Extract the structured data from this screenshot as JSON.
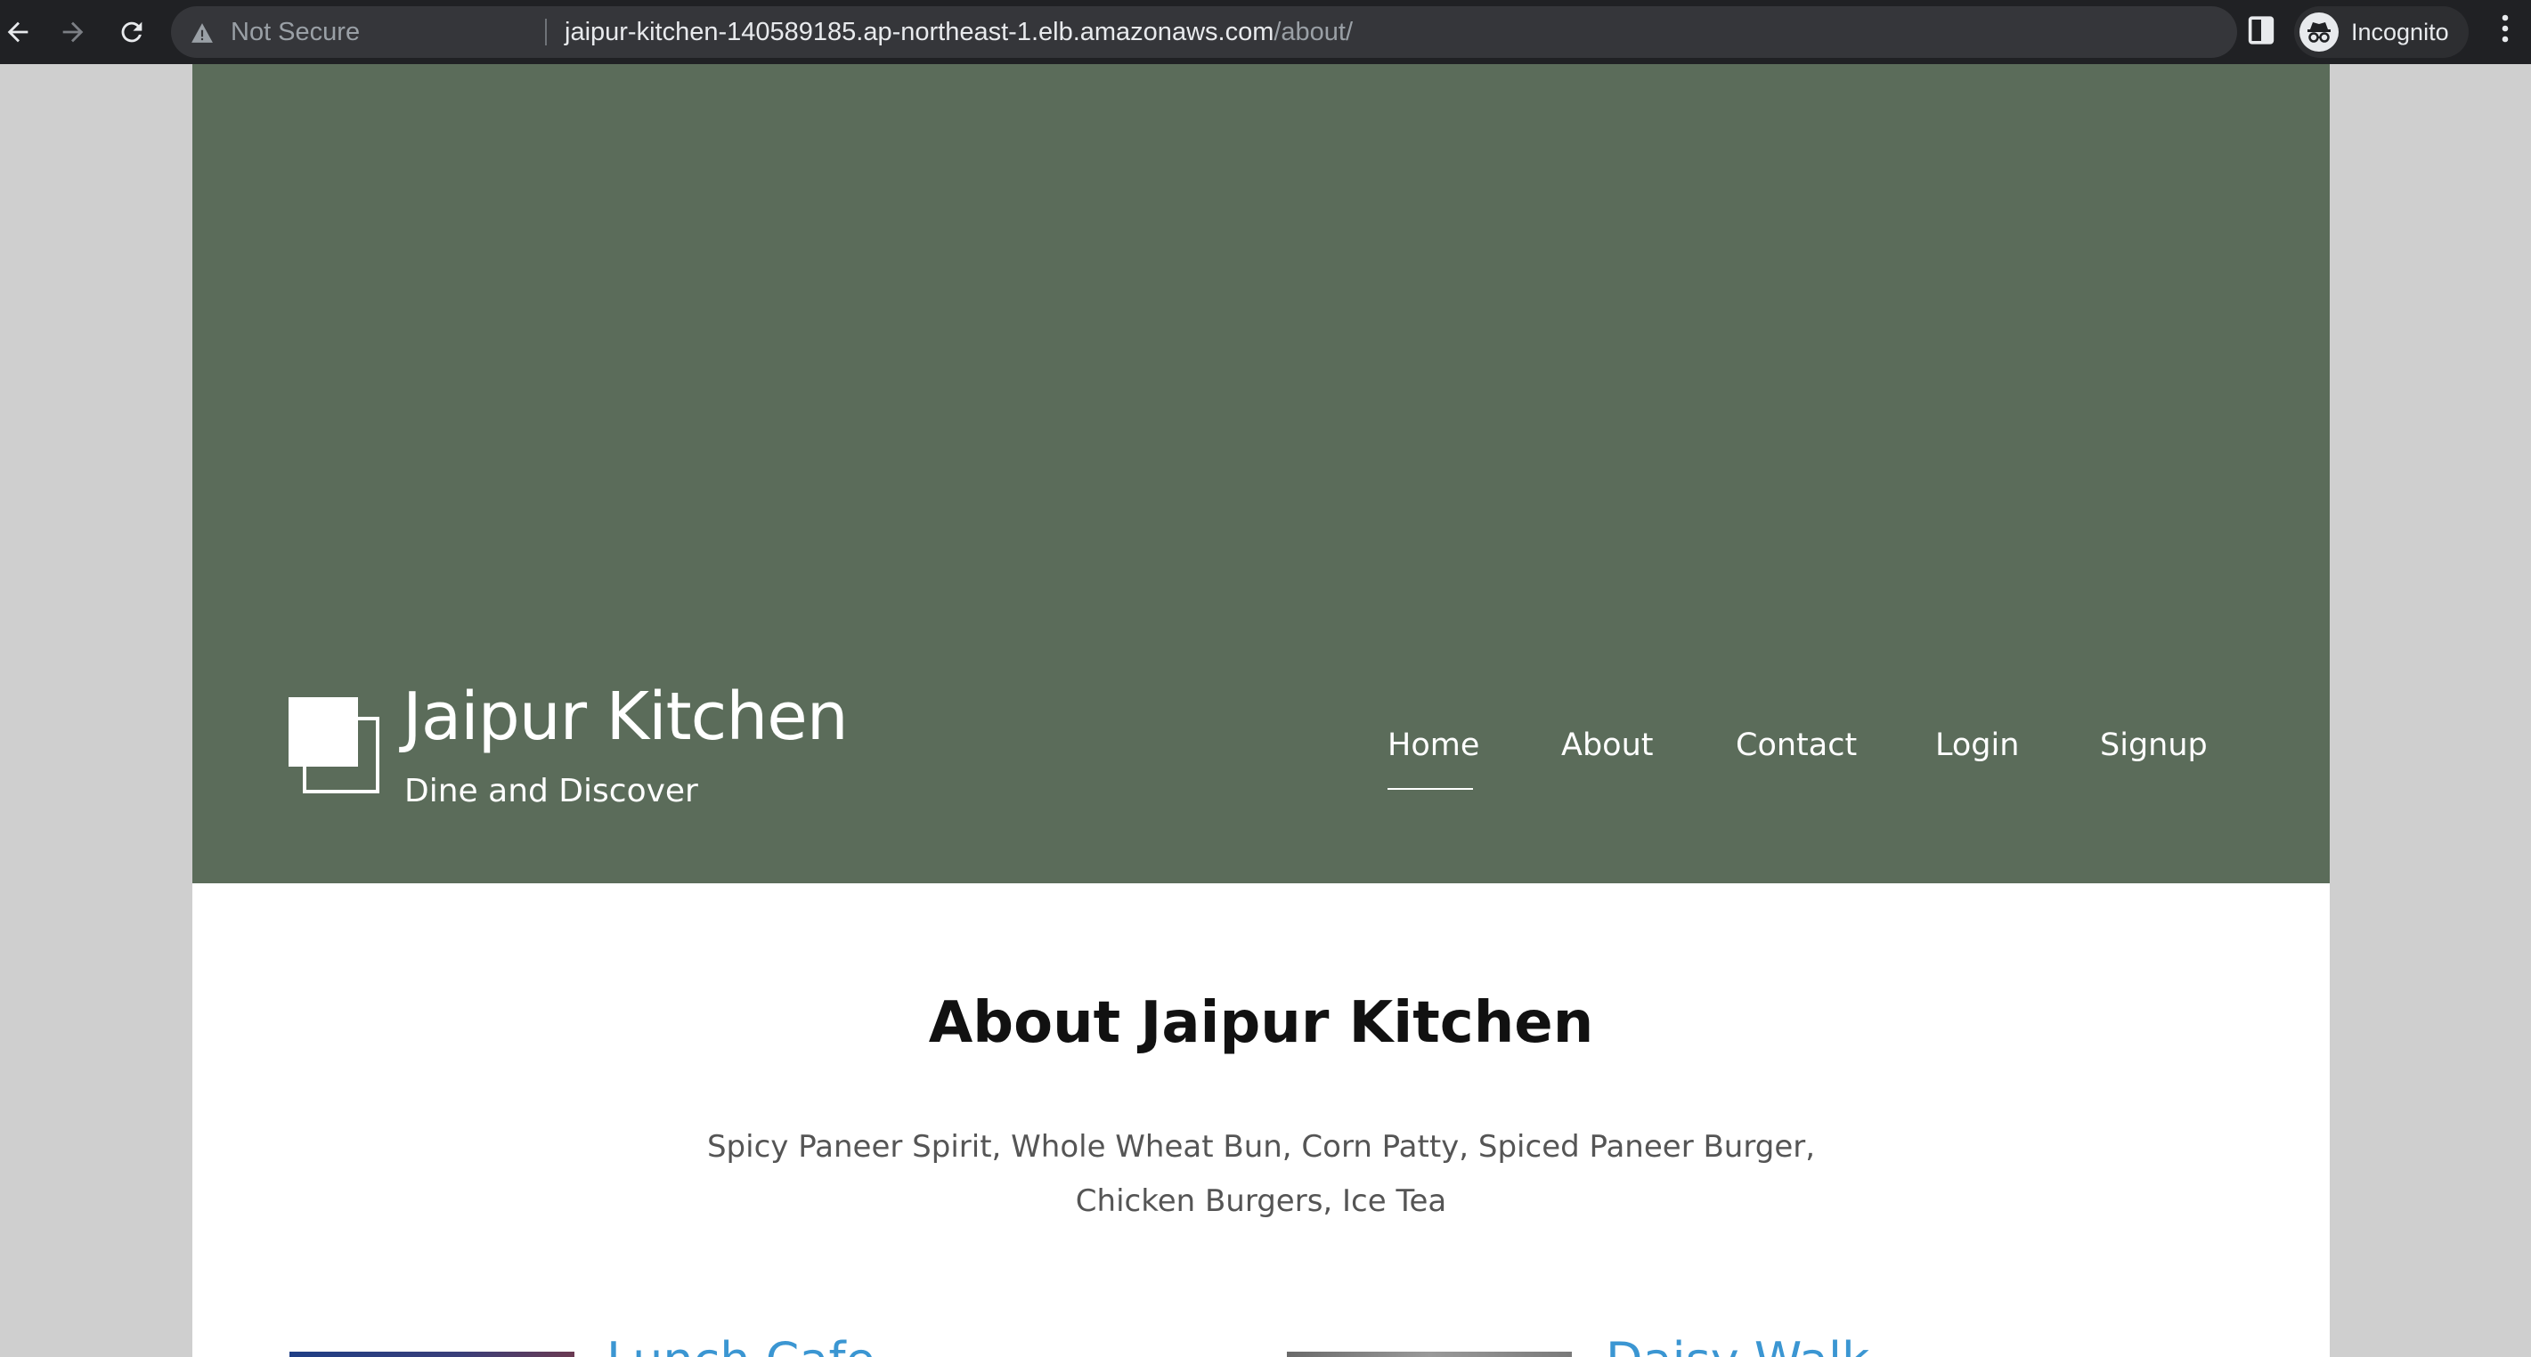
{
  "browser": {
    "security_label": "Not Secure",
    "url_host": "jaipur-kitchen-140589185.ap-northeast-1.elb.amazonaws.com",
    "url_path": "/about/",
    "profile_label": "Incognito",
    "icons": [
      "back-arrow-icon",
      "forward-arrow-icon",
      "reload-icon",
      "warning-icon",
      "star-icon",
      "side-panel-icon",
      "incognito-icon",
      "kebab-menu-icon"
    ]
  },
  "site": {
    "title": "Jaipur Kitchen",
    "tagline": "Dine and Discover",
    "hero_color": "#5b6c5a"
  },
  "nav": {
    "items": [
      {
        "label": "Home",
        "active": true
      },
      {
        "label": "About",
        "active": false
      },
      {
        "label": "Contact",
        "active": false
      },
      {
        "label": "Login",
        "active": false
      },
      {
        "label": "Signup",
        "active": false
      }
    ]
  },
  "about": {
    "heading": "About Jaipur Kitchen",
    "line1": "Spicy Paneer Spirit, Whole Wheat Bun, Corn Patty, Spiced Paneer Burger,",
    "line2": "Chicken Burgers, Ice Tea"
  },
  "cards": [
    {
      "title": "Lunch Cafe"
    },
    {
      "title": "Daisy Walk"
    }
  ],
  "colors": {
    "link": "#3b96d2",
    "chrome": "#202124"
  }
}
